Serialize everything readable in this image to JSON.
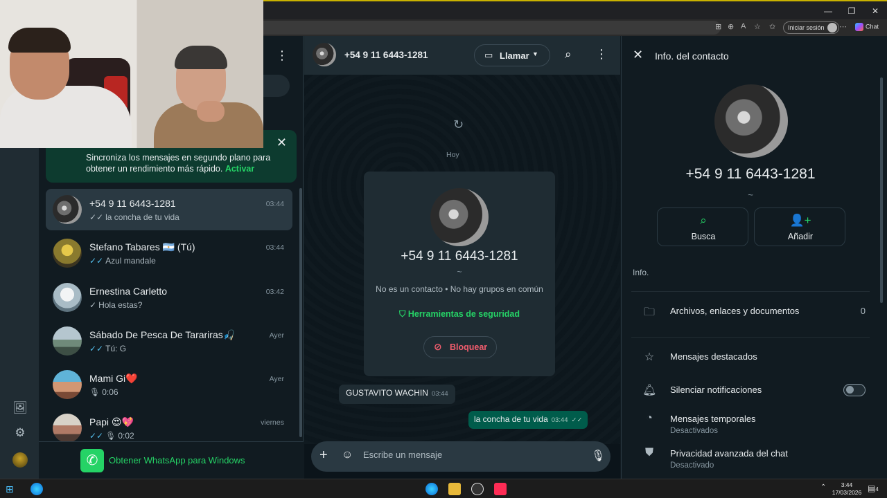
{
  "browser": {
    "signin_label": "Iniciar sesión",
    "chat_label": "Chat",
    "minimize_icon": "—",
    "restore_icon": "❐",
    "close_icon": "✕"
  },
  "sidebar": {
    "sync_banner": {
      "text": "Sincroniza los mensajes en segundo plano para obtener un rendimiento más rápido.",
      "action": "Activar"
    },
    "get_windows_label": "Obtener WhatsApp para Windows",
    "chats": [
      {
        "name": "+54 9 11 6443-1281",
        "time": "03:44",
        "last": "la concha de tu vida",
        "tick": "✓✓",
        "active": true
      },
      {
        "name": "Stefano Tabares 🇦🇷 (Tú)",
        "time": "03:44",
        "last": "Azul mandale",
        "tick": "✓✓"
      },
      {
        "name": "Ernestina Carletto",
        "time": "03:42",
        "last": "Hola estas?",
        "tick": "✓"
      },
      {
        "name": "Sábado De Pesca De Tarariras🎣",
        "time": "Ayer",
        "last": "Tú: G",
        "tick": "✓✓"
      },
      {
        "name": "Mami Gi❤️",
        "time": "Ayer",
        "last": "0:06",
        "tick": ""
      },
      {
        "name": "Papi 😍💖",
        "time": "viernes",
        "last": "0:02",
        "tick": "✓✓"
      }
    ]
  },
  "conversation": {
    "title": "+54 9 11 6443-1281",
    "call_label": "Llamar",
    "date_chip": "Hoy",
    "card": {
      "number": "+54 9 11 6443-1281",
      "tilde": "~",
      "subtitle": "No es un contacto • No hay grupos en común",
      "security_label": "Herramientas de seguridad",
      "block_label": "Bloquear"
    },
    "messages": [
      {
        "direction": "in",
        "text": "GUSTAVITO WACHIN",
        "time": "03:44"
      },
      {
        "direction": "out",
        "text": "la concha de tu vida",
        "time": "03:44",
        "tick": "✓✓"
      }
    ],
    "composer_placeholder": "Escribe un mensaje"
  },
  "info_panel": {
    "title": "Info. del contacto",
    "number": "+54 9 11 6443-1281",
    "tilde": "~",
    "actions": [
      {
        "label": "Busca",
        "icon": "search-icon"
      },
      {
        "label": "Añadir",
        "icon": "add-contact-icon"
      }
    ],
    "section_label": "Info.",
    "rows": [
      {
        "label": "Archivos, enlaces y documentos",
        "count": "0"
      },
      {
        "label": "Mensajes destacados"
      },
      {
        "label": "Silenciar notificaciones"
      },
      {
        "label": "Mensajes temporales",
        "sub": "Desactivados"
      },
      {
        "label": "Privacidad avanzada del chat",
        "sub": "Desactivado"
      }
    ]
  },
  "taskbar": {
    "time": "3:44",
    "date": "17/03/2026",
    "notif_count": "4"
  },
  "colors": {
    "accent": "#25d366",
    "bubble_out": "#005c4b",
    "danger": "#f15c6d"
  }
}
